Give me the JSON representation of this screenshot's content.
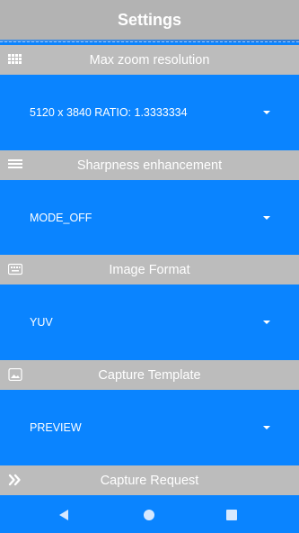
{
  "app": {
    "title": "Settings"
  },
  "sections": [
    {
      "header": "Max zoom resolution",
      "icon": "grid-icon",
      "value": "5120 x 3840 RATIO: 1.3333334"
    },
    {
      "header": "Sharpness enhancement",
      "icon": "lines-icon",
      "value": "MODE_OFF"
    },
    {
      "header": "Image Format",
      "icon": "keyboard-icon",
      "value": "YUV"
    },
    {
      "header": "Capture Template",
      "icon": "image-icon",
      "value": "PREVIEW"
    },
    {
      "header": "Capture Request",
      "icon": "double-chevron-icon"
    }
  ],
  "navbar": {
    "icons": [
      "back-icon",
      "home-icon",
      "recents-icon"
    ]
  },
  "colors": {
    "accent": "#0a84ff",
    "header": "#bcbcbc",
    "text": "#ffffff"
  }
}
